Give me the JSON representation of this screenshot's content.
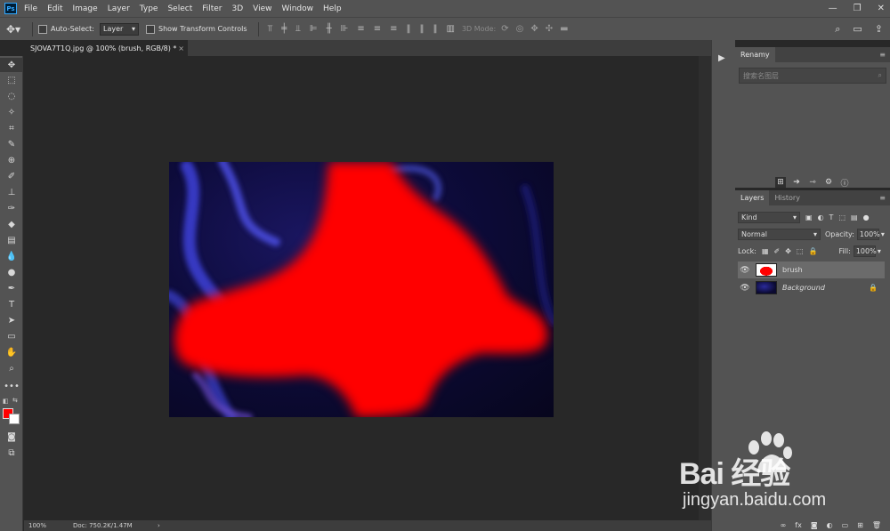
{
  "app": {
    "logo_text": "Ps"
  },
  "menu": [
    "File",
    "Edit",
    "Image",
    "Layer",
    "Type",
    "Select",
    "Filter",
    "3D",
    "View",
    "Window",
    "Help"
  ],
  "options": {
    "auto_select_label": "Auto-Select:",
    "auto_select_value": "Layer",
    "show_transform_label": "Show Transform Controls",
    "mode3d_label": "3D Mode:"
  },
  "document": {
    "tab_title": "SJOVA7T1Q.jpg @ 100% (brush, RGB/8) *",
    "close_glyph": "×"
  },
  "status": {
    "zoom": "100%",
    "doc_info": "Doc: 750.2K/1.47M",
    "arrow": "›"
  },
  "colors": {
    "foreground": "#ff0000",
    "background": "#ffffff",
    "photo_red": "#ff0000"
  },
  "renamy": {
    "tab_label": "Renamy",
    "search_placeholder": "搜索名图层"
  },
  "layers_panel": {
    "tabs": [
      "Layers",
      "History"
    ],
    "filter_kind": "Kind",
    "blend_mode": "Normal",
    "opacity_label": "Opacity:",
    "opacity_value": "100%",
    "lock_label": "Lock:",
    "fill_label": "Fill:",
    "fill_value": "100%",
    "layers": [
      {
        "name": "brush",
        "selected": true
      },
      {
        "name": "Background",
        "selected": false,
        "locked": true
      }
    ]
  },
  "watermark": {
    "logo": "Bai 经验",
    "url": "jingyan.baidu.com"
  }
}
